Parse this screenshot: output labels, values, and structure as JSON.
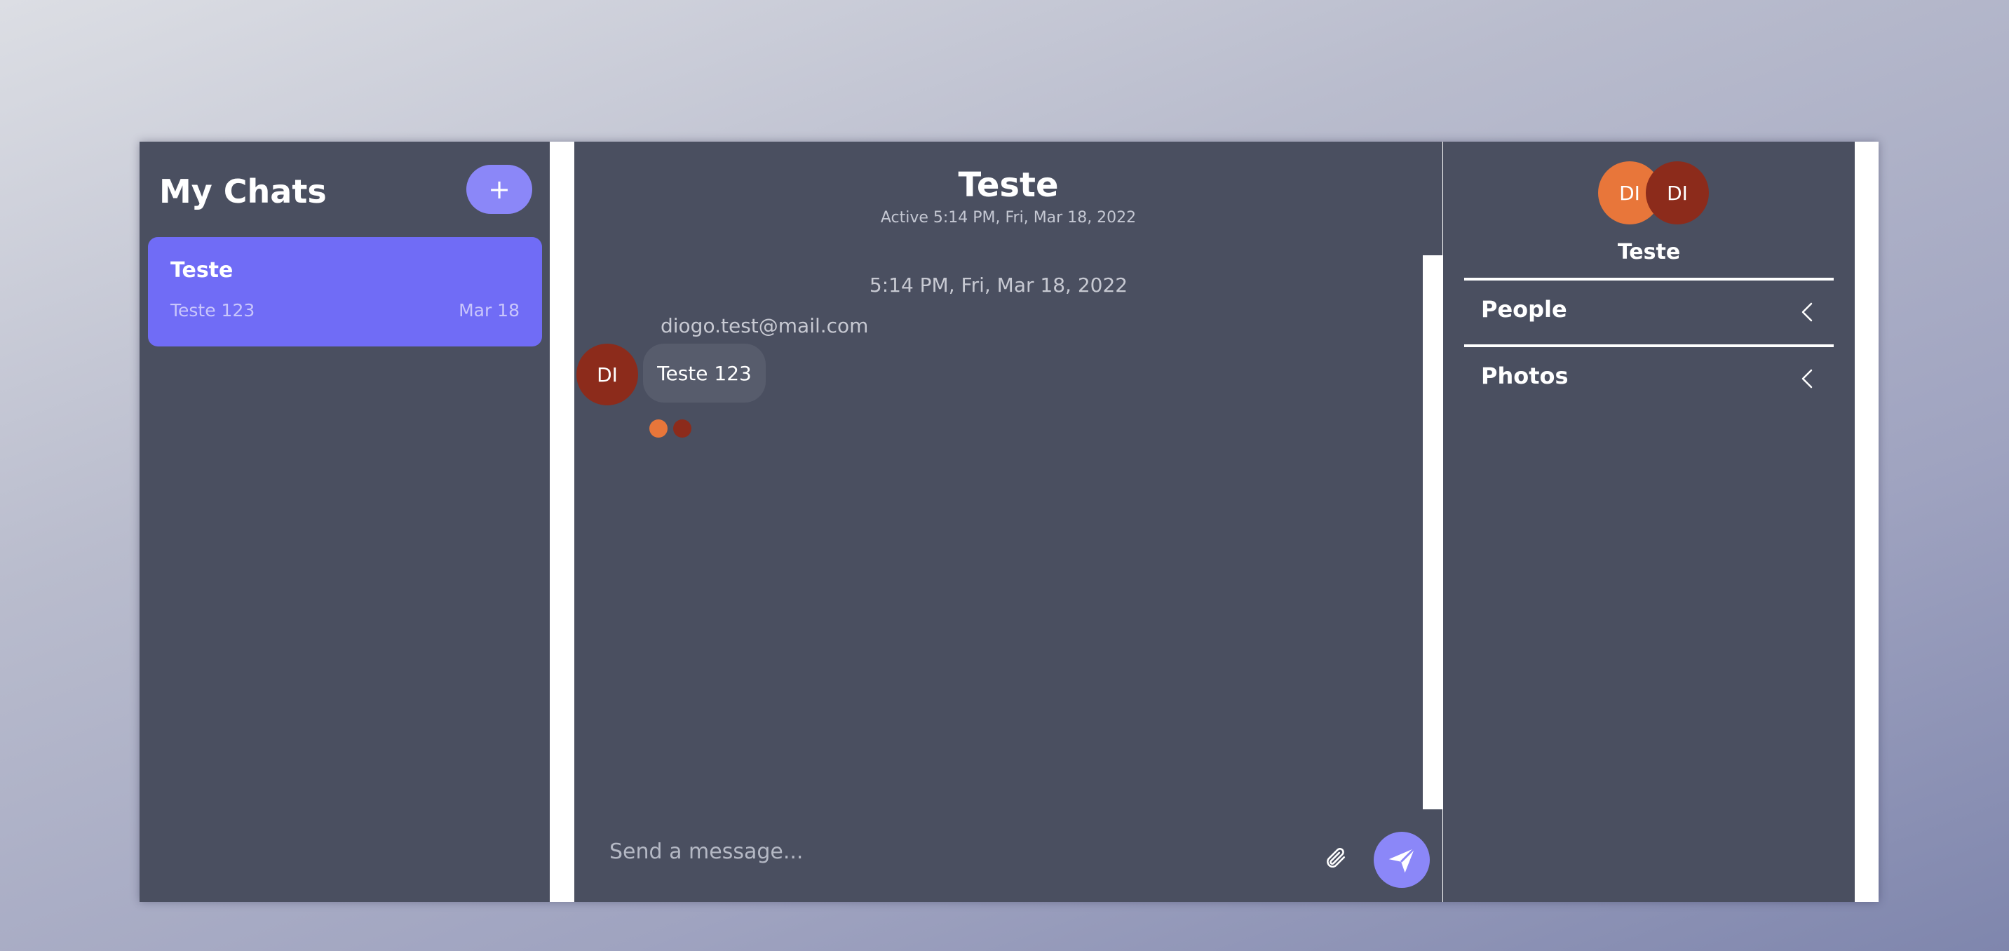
{
  "sidebar": {
    "title": "My Chats",
    "new_chat_label": "+",
    "chats": [
      {
        "name": "Teste",
        "preview": "Teste 123",
        "date": "Mar 18"
      }
    ]
  },
  "chat": {
    "title": "Teste",
    "active_status": "Active 5:14 PM, Fri, Mar 18, 2022",
    "messages": [
      {
        "timestamp": "5:14 PM, Fri, Mar 18, 2022",
        "sender": "diogo.test@mail.com",
        "avatar_initials": "DI",
        "avatar_color": "#8c2b1b",
        "text": "Teste 123",
        "read_receipt_colors": [
          "#e8763a",
          "#8c2b1b"
        ]
      }
    ],
    "composer": {
      "placeholder": "Send a message...",
      "attach_icon": "paperclip-icon",
      "send_icon": "send-icon"
    }
  },
  "details": {
    "participants": [
      {
        "initials": "DI",
        "color": "#e8763a"
      },
      {
        "initials": "DI",
        "color": "#8c2b1b"
      }
    ],
    "chat_name": "Teste",
    "sections": [
      {
        "label": "People",
        "icon": "chevron-left-icon"
      },
      {
        "label": "Photos",
        "icon": "chevron-left-icon"
      }
    ]
  },
  "colors": {
    "accent": "#706cf6",
    "accent_light": "#8b87f8",
    "panel": "#4a4f60"
  }
}
